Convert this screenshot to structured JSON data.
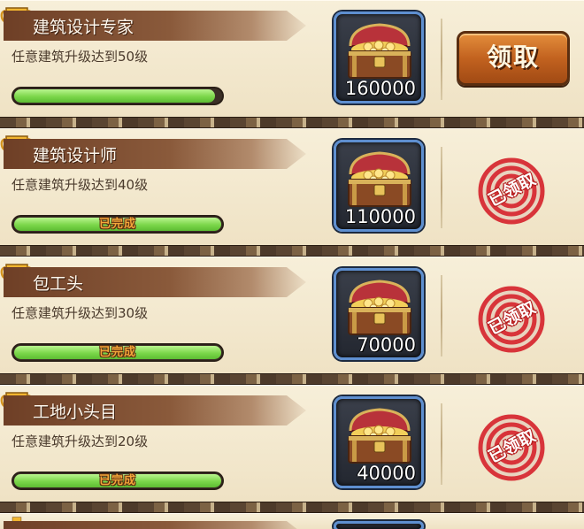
{
  "achievements": [
    {
      "title": "建筑设计专家",
      "description": "任意建筑升级达到50级",
      "progress": 0.97,
      "progress_text": "",
      "reward_amount": "160000",
      "status": "claimable",
      "claim_label": "领取",
      "claimed_label": ""
    },
    {
      "title": "建筑设计师",
      "description": "任意建筑升级达到40级",
      "progress": 1.0,
      "progress_text": "已完成",
      "reward_amount": "110000",
      "status": "claimed",
      "claim_label": "",
      "claimed_label": "已领取"
    },
    {
      "title": "包工头",
      "description": "任意建筑升级达到30级",
      "progress": 1.0,
      "progress_text": "已完成",
      "reward_amount": "70000",
      "status": "claimed",
      "claim_label": "",
      "claimed_label": "已领取"
    },
    {
      "title": "工地小头目",
      "description": "任意建筑升级达到20级",
      "progress": 1.0,
      "progress_text": "已完成",
      "reward_amount": "40000",
      "status": "claimed",
      "claim_label": "",
      "claimed_label": "已领取"
    }
  ],
  "icons": {
    "trophy": "trophy-icon",
    "chest": "treasure-chest-icon",
    "stamp": "claimed-stamp-icon"
  },
  "colors": {
    "progress_fill": "#7bd64a",
    "claim_button": "#c2621f",
    "stamp_red": "#d8343a",
    "chest_border": "#5e8fd0"
  }
}
